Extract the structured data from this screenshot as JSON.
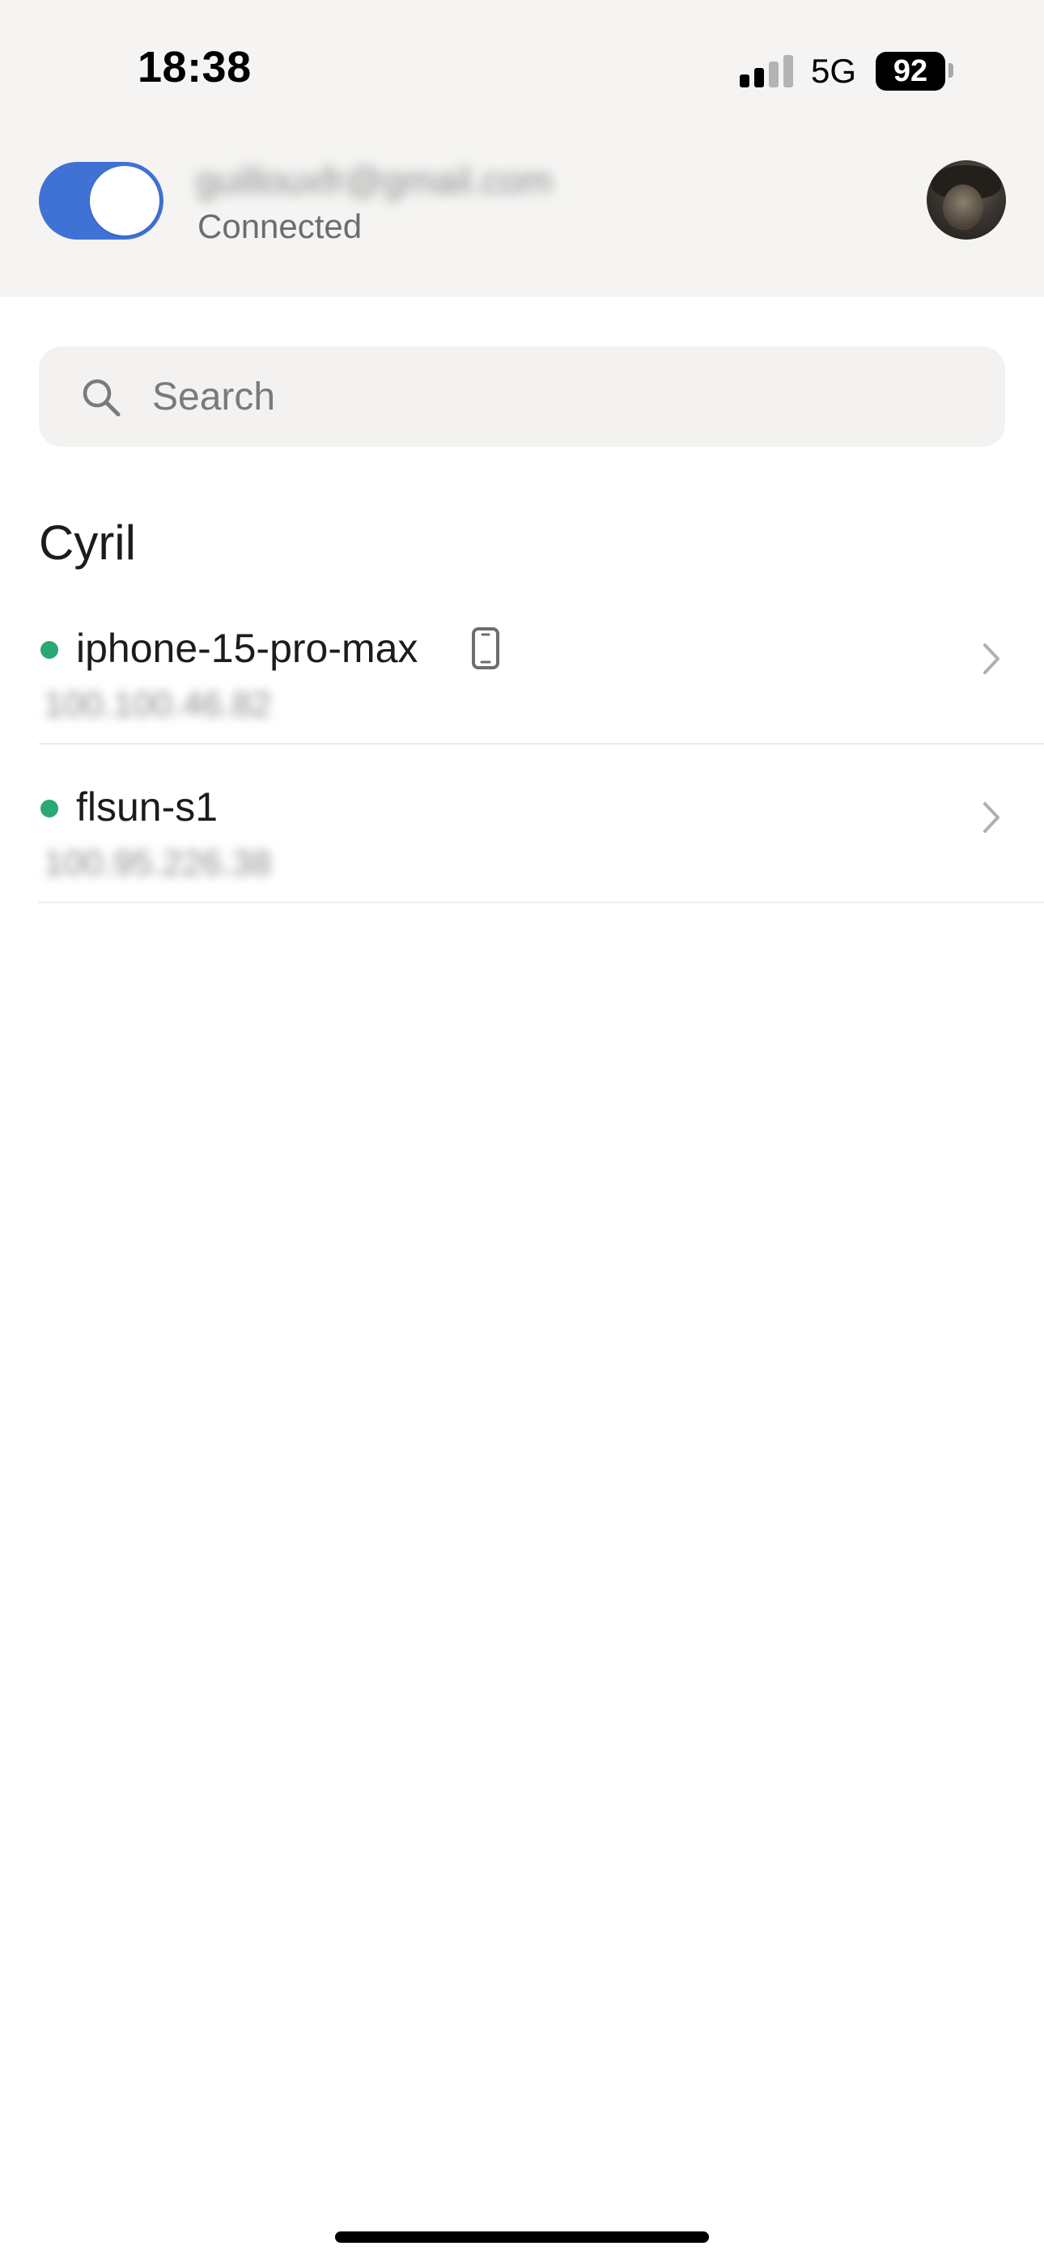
{
  "status_bar": {
    "time": "18:38",
    "network_type": "5G",
    "battery_level": "92",
    "signal_bars_active": 2,
    "signal_bars_total": 4
  },
  "account": {
    "email": "guillouxfr@gmail.com",
    "connection_status": "Connected",
    "vpn_enabled": true
  },
  "search": {
    "placeholder": "Search",
    "value": ""
  },
  "section": {
    "title": "Cyril",
    "devices": [
      {
        "name": "iphone-15-pro-max",
        "ip": "100.100.46.82",
        "online": true,
        "icon": "phone-icon"
      },
      {
        "name": "flsun-s1",
        "ip": "100.95.226.38",
        "online": true,
        "icon": ""
      }
    ]
  },
  "colors": {
    "accent": "#4072d6",
    "online": "#2aa876",
    "header_background": "#f5f4f2",
    "search_background": "#f3f2f0"
  }
}
